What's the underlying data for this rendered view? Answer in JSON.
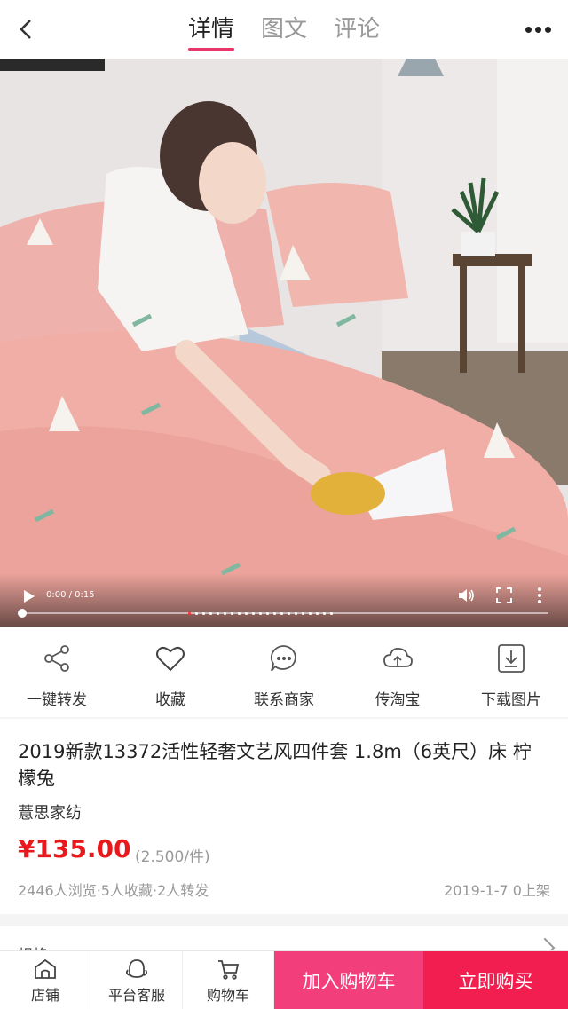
{
  "header": {
    "tabs": [
      {
        "label": "详情",
        "active": true
      },
      {
        "label": "图文",
        "active": false
      },
      {
        "label": "评论",
        "active": false
      }
    ],
    "accent_color": "#e8366b"
  },
  "video": {
    "time": "0:00 / 0:15",
    "progress": 0.0,
    "slide_count": 21,
    "active_slide": 1
  },
  "actions": [
    {
      "label": "一键转发",
      "icon": "share-icon"
    },
    {
      "label": "收藏",
      "icon": "heart-icon"
    },
    {
      "label": "联系商家",
      "icon": "chat-icon"
    },
    {
      "label": "传淘宝",
      "icon": "cloud-upload-icon"
    },
    {
      "label": "下载图片",
      "icon": "download-icon"
    }
  ],
  "product": {
    "title": "2019新款13372活性轻奢文艺风四件套 1.8m（6英尺）床 柠檬兔",
    "shop": "薏思家纺",
    "price": "¥135.00",
    "unit_price": "(2.500/件)",
    "stats": "2446人浏览·5人收藏·2人转发",
    "date": "2019-1-7 0上架",
    "price_color": "#e8181c"
  },
  "next_section": {
    "label": "规格"
  },
  "bottom_bar": {
    "store": "店铺",
    "service": "平台客服",
    "cart": "购物车",
    "add_to_cart": "加入购物车",
    "buy_now": "立即购买"
  }
}
